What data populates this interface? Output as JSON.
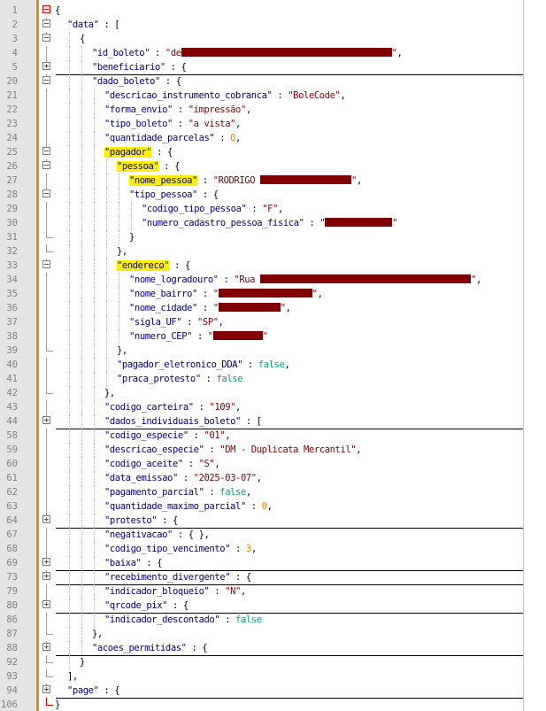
{
  "colors": {
    "key": "#000080",
    "string": "#800000",
    "number": "#ff8000",
    "boolean": "#00a08a",
    "highlight": "#ffee00",
    "redaction": "#800000",
    "fold_bar": "#e8861a"
  },
  "lines": [
    {
      "n": "1",
      "fold": "minus-red",
      "sep": false,
      "tokens": [
        {
          "t": "{",
          "c": "punc"
        }
      ]
    },
    {
      "n": "2",
      "fold": "minus",
      "sep": false,
      "indent": 1,
      "tokens": [
        {
          "t": "\"data\"",
          "c": "key"
        },
        {
          "t": " : [",
          "c": "punc"
        }
      ]
    },
    {
      "n": "3",
      "fold": "minus",
      "sep": false,
      "indent": 2,
      "tokens": [
        {
          "t": "{",
          "c": "punc"
        }
      ]
    },
    {
      "n": "4",
      "fold": "line",
      "sep": false,
      "indent": 3,
      "tokens": [
        {
          "t": "\"id_boleto\"",
          "c": "key"
        },
        {
          "t": " : ",
          "c": "punc"
        },
        {
          "t": "\"de",
          "c": "str"
        },
        {
          "redact": 238
        },
        {
          "t": "\"",
          "c": "str"
        },
        {
          "t": ",",
          "c": "punc"
        }
      ]
    },
    {
      "n": "5",
      "fold": "plus",
      "sep": true,
      "indent": 3,
      "tokens": [
        {
          "t": "\"beneficiario\"",
          "c": "key"
        },
        {
          "t": " : {",
          "c": "punc"
        }
      ]
    },
    {
      "n": "20",
      "fold": "minus",
      "sep": false,
      "indent": 3,
      "tokens": [
        {
          "t": "\"dado_boleto\"",
          "c": "key"
        },
        {
          "t": " : {",
          "c": "punc"
        }
      ]
    },
    {
      "n": "21",
      "fold": "line",
      "sep": false,
      "indent": 4,
      "tokens": [
        {
          "t": "\"descricao_instrumento_cobranca\"",
          "c": "key"
        },
        {
          "t": " : ",
          "c": "punc"
        },
        {
          "t": "\"BoleCode\"",
          "c": "str"
        },
        {
          "t": ",",
          "c": "punc"
        }
      ]
    },
    {
      "n": "22",
      "fold": "line",
      "sep": false,
      "indent": 4,
      "tokens": [
        {
          "t": "\"forma_envio\"",
          "c": "key"
        },
        {
          "t": " : ",
          "c": "punc"
        },
        {
          "t": "\"impressão\"",
          "c": "str"
        },
        {
          "t": ",",
          "c": "punc"
        }
      ]
    },
    {
      "n": "23",
      "fold": "line",
      "sep": false,
      "indent": 4,
      "tokens": [
        {
          "t": "\"tipo_boleto\"",
          "c": "key"
        },
        {
          "t": " : ",
          "c": "punc"
        },
        {
          "t": "\"a vista\"",
          "c": "str"
        },
        {
          "t": ",",
          "c": "punc"
        }
      ]
    },
    {
      "n": "24",
      "fold": "line",
      "sep": false,
      "indent": 4,
      "tokens": [
        {
          "t": "\"quantidade_parcelas\"",
          "c": "key"
        },
        {
          "t": " : ",
          "c": "punc"
        },
        {
          "t": "0",
          "c": "num"
        },
        {
          "t": ",",
          "c": "punc"
        }
      ]
    },
    {
      "n": "25",
      "fold": "minus",
      "sep": false,
      "indent": 4,
      "tokens": [
        {
          "t": "\"pagador\"",
          "c": "key",
          "hl": true
        },
        {
          "t": " : {",
          "c": "punc"
        }
      ]
    },
    {
      "n": "26",
      "fold": "minus",
      "sep": false,
      "indent": 5,
      "tokens": [
        {
          "t": "\"pessoa\"",
          "c": "key",
          "hl": true
        },
        {
          "t": " : {",
          "c": "punc"
        }
      ]
    },
    {
      "n": "27",
      "fold": "line",
      "sep": false,
      "indent": 6,
      "tokens": [
        {
          "t": "\"nome_pessoa\"",
          "c": "key",
          "hl": true
        },
        {
          "t": " : ",
          "c": "punc"
        },
        {
          "t": "\"RODRIGO ",
          "c": "str"
        },
        {
          "redact": 103
        },
        {
          "t": "\"",
          "c": "str"
        },
        {
          "t": ",",
          "c": "punc"
        }
      ]
    },
    {
      "n": "28",
      "fold": "minus",
      "sep": false,
      "indent": 6,
      "tokens": [
        {
          "t": "\"tipo_pessoa\"",
          "c": "key"
        },
        {
          "t": " : {",
          "c": "punc"
        }
      ]
    },
    {
      "n": "29",
      "fold": "line",
      "sep": false,
      "indent": 7,
      "tokens": [
        {
          "t": "\"codigo_tipo_pessoa\"",
          "c": "key"
        },
        {
          "t": " : ",
          "c": "punc"
        },
        {
          "t": "\"F\"",
          "c": "str"
        },
        {
          "t": ",",
          "c": "punc"
        }
      ]
    },
    {
      "n": "30",
      "fold": "line",
      "sep": false,
      "indent": 7,
      "tokens": [
        {
          "t": "\"numero_cadastro_pessoa_fisica\"",
          "c": "key"
        },
        {
          "t": " : ",
          "c": "punc"
        },
        {
          "t": "\"",
          "c": "str"
        },
        {
          "redact": 76
        },
        {
          "t": "\"",
          "c": "str"
        }
      ]
    },
    {
      "n": "31",
      "fold": "end",
      "sep": false,
      "indent": 6,
      "tokens": [
        {
          "t": "}",
          "c": "punc"
        }
      ]
    },
    {
      "n": "32",
      "fold": "end",
      "sep": false,
      "indent": 5,
      "tokens": [
        {
          "t": "},",
          "c": "punc"
        }
      ]
    },
    {
      "n": "33",
      "fold": "minus",
      "sep": false,
      "indent": 5,
      "tokens": [
        {
          "t": "\"endereco\"",
          "c": "key",
          "hl": true
        },
        {
          "t": " : {",
          "c": "punc"
        }
      ]
    },
    {
      "n": "34",
      "fold": "line",
      "sep": false,
      "indent": 6,
      "tokens": [
        {
          "t": "\"nome_logradouro\"",
          "c": "key"
        },
        {
          "t": " : ",
          "c": "punc"
        },
        {
          "t": "\"Rua ",
          "c": "str"
        },
        {
          "redact": 238
        },
        {
          "t": "\"",
          "c": "str"
        },
        {
          "t": ",",
          "c": "punc"
        }
      ]
    },
    {
      "n": "35",
      "fold": "line",
      "sep": false,
      "indent": 6,
      "tokens": [
        {
          "t": "\"nome_bairro\"",
          "c": "key"
        },
        {
          "t": " : ",
          "c": "punc"
        },
        {
          "t": "\"",
          "c": "str"
        },
        {
          "redact": 106
        },
        {
          "t": "\"",
          "c": "str"
        },
        {
          "t": ",",
          "c": "punc"
        }
      ]
    },
    {
      "n": "36",
      "fold": "line",
      "sep": false,
      "indent": 6,
      "tokens": [
        {
          "t": "\"nome_cidade\"",
          "c": "key"
        },
        {
          "t": " : ",
          "c": "punc"
        },
        {
          "t": "\"",
          "c": "str"
        },
        {
          "redact": 70
        },
        {
          "t": "\"",
          "c": "str"
        },
        {
          "t": ",",
          "c": "punc"
        }
      ]
    },
    {
      "n": "37",
      "fold": "line",
      "sep": false,
      "indent": 6,
      "tokens": [
        {
          "t": "\"sigla_UF\"",
          "c": "key"
        },
        {
          "t": " : ",
          "c": "punc"
        },
        {
          "t": "\"SP\"",
          "c": "str"
        },
        {
          "t": ",",
          "c": "punc"
        }
      ]
    },
    {
      "n": "38",
      "fold": "line",
      "sep": false,
      "indent": 6,
      "tokens": [
        {
          "t": "\"numero_CEP\"",
          "c": "key"
        },
        {
          "t": " : ",
          "c": "punc"
        },
        {
          "t": "\"",
          "c": "str"
        },
        {
          "redact": 56
        },
        {
          "t": "\"",
          "c": "str"
        }
      ]
    },
    {
      "n": "39",
      "fold": "end",
      "sep": false,
      "indent": 5,
      "tokens": [
        {
          "t": "},",
          "c": "punc"
        }
      ]
    },
    {
      "n": "40",
      "fold": "line",
      "sep": false,
      "indent": 5,
      "tokens": [
        {
          "t": "\"pagador_eletronico_DDA\"",
          "c": "key"
        },
        {
          "t": " : ",
          "c": "punc"
        },
        {
          "t": "false",
          "c": "bool"
        },
        {
          "t": ",",
          "c": "punc"
        }
      ]
    },
    {
      "n": "41",
      "fold": "line",
      "sep": false,
      "indent": 5,
      "tokens": [
        {
          "t": "\"praca_protesto\"",
          "c": "key"
        },
        {
          "t": " : ",
          "c": "punc"
        },
        {
          "t": "false",
          "c": "bool"
        }
      ]
    },
    {
      "n": "42",
      "fold": "end",
      "sep": false,
      "indent": 4,
      "tokens": [
        {
          "t": "},",
          "c": "punc"
        }
      ]
    },
    {
      "n": "43",
      "fold": "line",
      "sep": false,
      "indent": 4,
      "tokens": [
        {
          "t": "\"codigo_carteira\"",
          "c": "key"
        },
        {
          "t": " : ",
          "c": "punc"
        },
        {
          "t": "\"109\"",
          "c": "str"
        },
        {
          "t": ",",
          "c": "punc"
        }
      ]
    },
    {
      "n": "44",
      "fold": "plus",
      "sep": true,
      "indent": 4,
      "tokens": [
        {
          "t": "\"dados_individuais_boleto\"",
          "c": "key"
        },
        {
          "t": " : [",
          "c": "punc"
        }
      ]
    },
    {
      "n": "58",
      "fold": "line",
      "sep": false,
      "indent": 4,
      "tokens": [
        {
          "t": "\"codigo_especie\"",
          "c": "key"
        },
        {
          "t": " : ",
          "c": "punc"
        },
        {
          "t": "\"01\"",
          "c": "str"
        },
        {
          "t": ",",
          "c": "punc"
        }
      ]
    },
    {
      "n": "59",
      "fold": "line",
      "sep": false,
      "indent": 4,
      "tokens": [
        {
          "t": "\"descricao_especie\"",
          "c": "key"
        },
        {
          "t": " : ",
          "c": "punc"
        },
        {
          "t": "\"DM - Duplicata Mercantil\"",
          "c": "str"
        },
        {
          "t": ",",
          "c": "punc"
        }
      ]
    },
    {
      "n": "60",
      "fold": "line",
      "sep": false,
      "indent": 4,
      "tokens": [
        {
          "t": "\"codigo_aceite\"",
          "c": "key"
        },
        {
          "t": " : ",
          "c": "punc"
        },
        {
          "t": "\"S\"",
          "c": "str"
        },
        {
          "t": ",",
          "c": "punc"
        }
      ]
    },
    {
      "n": "61",
      "fold": "line",
      "sep": false,
      "indent": 4,
      "tokens": [
        {
          "t": "\"data_emissao\"",
          "c": "key"
        },
        {
          "t": " : ",
          "c": "punc"
        },
        {
          "t": "\"2025-03-07\"",
          "c": "str"
        },
        {
          "t": ",",
          "c": "punc"
        }
      ]
    },
    {
      "n": "62",
      "fold": "line",
      "sep": false,
      "indent": 4,
      "tokens": [
        {
          "t": "\"pagamento_parcial\"",
          "c": "key"
        },
        {
          "t": " : ",
          "c": "punc"
        },
        {
          "t": "false",
          "c": "bool"
        },
        {
          "t": ",",
          "c": "punc"
        }
      ]
    },
    {
      "n": "63",
      "fold": "line",
      "sep": false,
      "indent": 4,
      "tokens": [
        {
          "t": "\"quantidade_maximo_parcial\"",
          "c": "key"
        },
        {
          "t": " : ",
          "c": "punc"
        },
        {
          "t": "0",
          "c": "num"
        },
        {
          "t": ",",
          "c": "punc"
        }
      ]
    },
    {
      "n": "64",
      "fold": "plus",
      "sep": true,
      "indent": 4,
      "tokens": [
        {
          "t": "\"protesto\"",
          "c": "key"
        },
        {
          "t": " : {",
          "c": "punc"
        }
      ]
    },
    {
      "n": "67",
      "fold": "line",
      "sep": false,
      "indent": 4,
      "tokens": [
        {
          "t": "\"negativacao\"",
          "c": "key"
        },
        {
          "t": " : { },",
          "c": "punc"
        }
      ]
    },
    {
      "n": "68",
      "fold": "line",
      "sep": false,
      "indent": 4,
      "tokens": [
        {
          "t": "\"codigo_tipo_vencimento\"",
          "c": "key"
        },
        {
          "t": " : ",
          "c": "punc"
        },
        {
          "t": "3",
          "c": "num"
        },
        {
          "t": ",",
          "c": "punc"
        }
      ]
    },
    {
      "n": "69",
      "fold": "plus",
      "sep": true,
      "indent": 4,
      "tokens": [
        {
          "t": "\"baixa\"",
          "c": "key"
        },
        {
          "t": " : {",
          "c": "punc"
        }
      ]
    },
    {
      "n": "73",
      "fold": "plus",
      "sep": true,
      "indent": 4,
      "tokens": [
        {
          "t": "\"recebimento_divergente\"",
          "c": "key"
        },
        {
          "t": " : {",
          "c": "punc"
        }
      ]
    },
    {
      "n": "79",
      "fold": "line",
      "sep": false,
      "indent": 4,
      "tokens": [
        {
          "t": "\"indicador_bloqueio\"",
          "c": "key"
        },
        {
          "t": " : ",
          "c": "punc"
        },
        {
          "t": "\"N\"",
          "c": "str"
        },
        {
          "t": ",",
          "c": "punc"
        }
      ]
    },
    {
      "n": "80",
      "fold": "plus",
      "sep": true,
      "indent": 4,
      "tokens": [
        {
          "t": "\"qrcode_pix\"",
          "c": "key"
        },
        {
          "t": " : {",
          "c": "punc"
        }
      ]
    },
    {
      "n": "86",
      "fold": "line",
      "sep": false,
      "indent": 4,
      "tokens": [
        {
          "t": "\"indicador_descontado\"",
          "c": "key"
        },
        {
          "t": " : ",
          "c": "punc"
        },
        {
          "t": "false",
          "c": "bool"
        }
      ]
    },
    {
      "n": "87",
      "fold": "end",
      "sep": false,
      "indent": 3,
      "tokens": [
        {
          "t": "},",
          "c": "punc"
        }
      ]
    },
    {
      "n": "88",
      "fold": "plus",
      "sep": true,
      "indent": 3,
      "tokens": [
        {
          "t": "\"acoes_permitidas\"",
          "c": "key"
        },
        {
          "t": " : {",
          "c": "punc"
        }
      ]
    },
    {
      "n": "92",
      "fold": "end",
      "sep": false,
      "indent": 2,
      "tokens": [
        {
          "t": "}",
          "c": "punc"
        }
      ]
    },
    {
      "n": "93",
      "fold": "end",
      "sep": false,
      "indent": 1,
      "tokens": [
        {
          "t": "],",
          "c": "punc"
        }
      ]
    },
    {
      "n": "94",
      "fold": "plus",
      "sep": true,
      "indent": 1,
      "tokens": [
        {
          "t": "\"page\"",
          "c": "key"
        },
        {
          "t": " : {",
          "c": "punc"
        }
      ]
    },
    {
      "n": "106",
      "fold": "end-red",
      "sep": false,
      "indent": 0,
      "tokens": [
        {
          "t": "}",
          "c": "punc"
        }
      ]
    }
  ]
}
